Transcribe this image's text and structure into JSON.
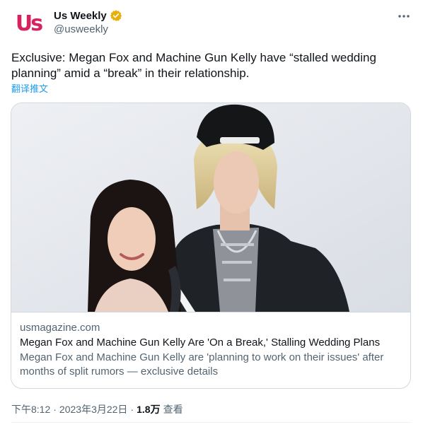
{
  "account": {
    "avatar_text": "Us",
    "display_name": "Us Weekly",
    "handle": "@usweekly",
    "verified_color": "#e8b00b"
  },
  "tweet": {
    "text": "Exclusive: Megan Fox and Machine Gun Kelly have “stalled wedding planning” amid a “break” in their relationship.",
    "translate_label": "翻译推文"
  },
  "card": {
    "domain": "usmagazine.com",
    "title": "Megan Fox and Machine Gun Kelly Are 'On a Break,' Stalling Wedding Plans",
    "description": "Megan Fox and Machine Gun Kelly are 'planning to work on their issues' after months of split rumors — exclusive details"
  },
  "meta": {
    "time": "下午8:12",
    "separator": "·",
    "date": "2023年3月22日",
    "views_count": "1.8万",
    "views_label": "查看"
  },
  "colors": {
    "brand": "#d6235f",
    "link": "#1d9bf0",
    "secondary_text": "#536471",
    "border": "#cfd9de"
  }
}
